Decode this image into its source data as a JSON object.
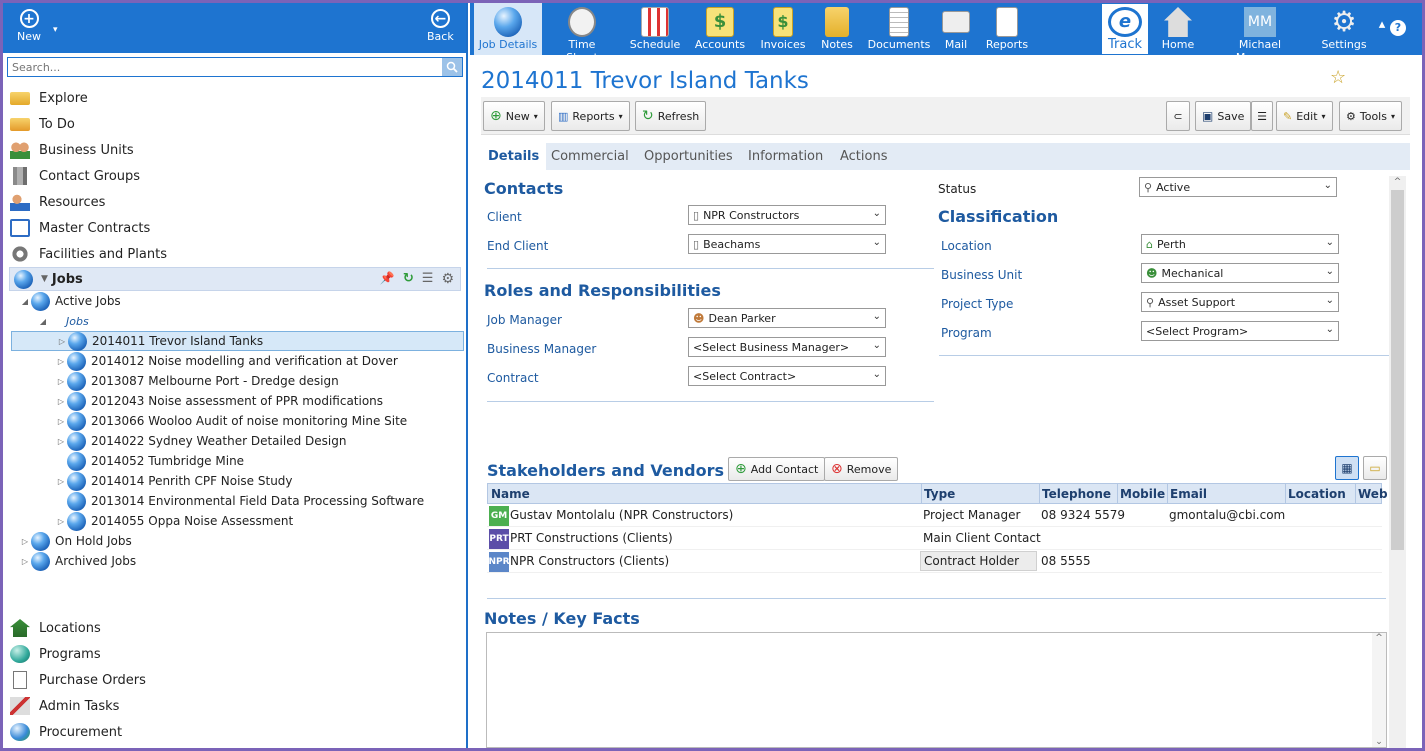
{
  "left": {
    "new_label": "New",
    "back_label": "Back",
    "search_placeholder": "Search...",
    "nav_items": [
      "Explore",
      "To Do",
      "Business Units",
      "Contact Groups",
      "Resources",
      "Master Contracts",
      "Facilities and Plants"
    ],
    "jobs_label": "Jobs",
    "tree": {
      "active_jobs": "Active Jobs",
      "jobs_sub": "Jobs",
      "jobs": [
        "2014011 Trevor Island Tanks",
        "2014012 Noise modelling and verification at Dover",
        "2013087 Melbourne Port - Dredge design",
        "2012043 Noise assessment of PPR modifications",
        "2013066 Wooloo Audit of noise monitoring Mine Site",
        "2014022 Sydney Weather Detailed Design",
        "2014052 Tumbridge Mine",
        "2014014 Penrith CPF Noise Study",
        "2013014 Environmental Field Data Processing Software",
        "2014055 Oppa Noise Assessment"
      ],
      "on_hold": "On Hold Jobs",
      "archived": "Archived Jobs"
    },
    "bottom_items": [
      "Locations",
      "Programs",
      "Purchase Orders",
      "Admin Tasks",
      "Procurement"
    ]
  },
  "topbar": {
    "items": [
      "Job Details",
      "Time Sheet",
      "Schedule",
      "Accounts",
      "Invoices",
      "Notes",
      "Documents",
      "Mail",
      "Reports"
    ],
    "track": "Track",
    "home": "Home",
    "user_initials": "MM",
    "user_name": "Michael Manager",
    "settings": "Settings",
    "help": "?"
  },
  "page": {
    "title": "2014011 Trevor Island Tanks"
  },
  "toolbar": {
    "new": "New",
    "reports": "Reports",
    "refresh": "Refresh",
    "save": "Save",
    "edit": "Edit",
    "tools": "Tools"
  },
  "tabs": [
    "Details",
    "Commercial",
    "Opportunities",
    "Information",
    "Actions"
  ],
  "details": {
    "contacts_h": "Contacts",
    "client_label": "Client",
    "client_value": "NPR Constructors",
    "end_client_label": "End Client",
    "end_client_value": "Beachams",
    "roles_h": "Roles and Responsibilities",
    "job_manager_label": "Job Manager",
    "job_manager_value": "Dean Parker",
    "business_manager_label": "Business Manager",
    "business_manager_value": "<Select Business Manager>",
    "contract_label": "Contract",
    "contract_value": "<Select Contract>",
    "status_label": "Status",
    "status_value": "Active",
    "classification_h": "Classification",
    "location_label": "Location",
    "location_value": "Perth",
    "business_unit_label": "Business Unit",
    "business_unit_value": "Mechanical",
    "project_type_label": "Project Type",
    "project_type_value": "Asset Support",
    "program_label": "Program",
    "program_value": "<Select Program>"
  },
  "stakeholders": {
    "heading": "Stakeholders and Vendors",
    "add_contact": "Add Contact",
    "remove": "Remove",
    "columns": [
      "Name",
      "Type",
      "Telephone",
      "Mobile",
      "Email",
      "Location",
      "Web"
    ],
    "rows": [
      {
        "avatar": "GM",
        "avatar_color": "#4caf50",
        "name": "Gustav Montolalu (NPR Constructors)",
        "type": "Project Manager",
        "telephone": "08 9324 5579",
        "mobile": "",
        "email": "gmontalu@cbi.com",
        "location": "",
        "web": ""
      },
      {
        "avatar": "PRT",
        "avatar_color": "#5b4ea8",
        "name": "PRT Constructions (Clients)",
        "type": "Main Client Contact",
        "telephone": "",
        "mobile": "",
        "email": "",
        "location": "",
        "web": ""
      },
      {
        "avatar": "NPR",
        "avatar_color": "#5b86c8",
        "name": "NPR Constructors (Clients)",
        "type": "Contract Holder",
        "telephone": "08 5555",
        "mobile": "",
        "email": "",
        "location": "",
        "web": ""
      }
    ]
  },
  "notes": {
    "heading": "Notes / Key Facts"
  },
  "colors": {
    "brand_blue": "#1e74d0",
    "heading_blue": "#1e5aa0",
    "frame_purple": "#7b63b8"
  }
}
